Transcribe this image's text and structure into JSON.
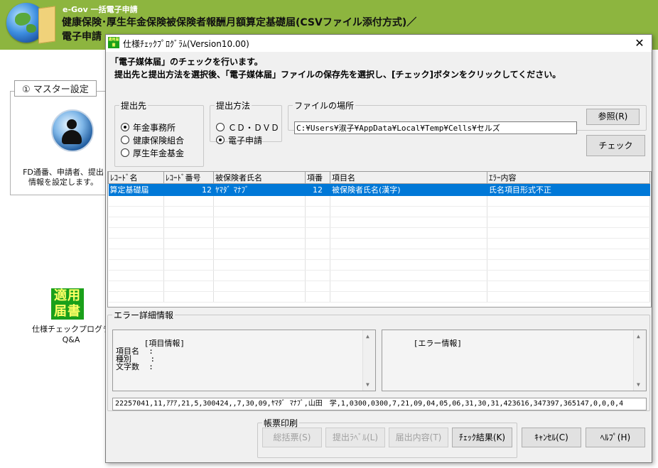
{
  "app": {
    "subtitle": "e-Gov 一括電子申請",
    "title_line1": "健康保険･厚生年金保険被保険者報酬月額算定基礎届(CSVファイル添付方式)／",
    "title_line2": "電子申請",
    "master_tab": "① マスター設定",
    "master_desc": "FD通番、申請者、提出\n情報を設定します。",
    "tekiyo_icon": "適用\n届書",
    "spec_label": "仕様チェックプログラ\nQ&A"
  },
  "dialog": {
    "title": "仕様ﾁｪｯｸﾌﾟﾛｸﾞﾗﾑ(Version10.00)",
    "close": "✕",
    "icon_text": "適用届書",
    "instruction1": "「電子媒体届」のチェックを行います。",
    "instruction2": "提出先と提出方法を選択後、「電子媒体届」ファイルの保存先を選択し、[チェック]ボタンをクリックしてください。",
    "destination": {
      "legend": "提出先",
      "options": [
        "年金事務所",
        "健康保険組合",
        "厚生年金基金"
      ],
      "selected": 0
    },
    "method": {
      "legend": "提出方法",
      "options": [
        "ＣＤ・ＤＶＤ",
        "電子申請"
      ],
      "selected": 1
    },
    "file": {
      "legend": "ファイルの場所",
      "path": "C:¥Users¥淑子¥AppData¥Local¥Temp¥Cells¥セルズ",
      "browse": "参照(R)"
    },
    "check_button": "チェック",
    "grid": {
      "columns": [
        "ﾚｺｰﾄﾞ名",
        "ﾚｺｰﾄﾞ番号",
        "被保険者氏名",
        "項番",
        "項目名",
        "ｴﾗｰ内容"
      ],
      "rows": [
        [
          "算定基礎届",
          "12",
          "ﾔﾏﾀﾞ ﾏﾅﾌﾞ",
          "12",
          "被保険者氏名(漢字)",
          "氏名項目形式不正"
        ]
      ]
    },
    "error_detail": {
      "legend": "エラー詳細情報",
      "item_info": "[項目情報]\n項目名  :\n種別    :\n文字数  :",
      "error_info": "[エラー情報]",
      "data_line": "22257041,11,ｱｱｱ,21,5,300424,,7,30,09,ﾔﾏﾀﾞ ﾏﾅﾌﾞ,山田　学,1,0300,0300,7,21,09,04,05,06,31,30,31,423616,347397,365147,0,0,0,4"
    },
    "print": {
      "legend": "帳票印刷",
      "summary": "総括票(S)",
      "label": "提出ﾗﾍﾞﾙ(L)",
      "content": "届出内容(T)",
      "result": "ﾁｪｯｸ結果(K)"
    },
    "cancel": "ｷｬﾝｾﾙ(C)",
    "help": "ﾍﾙﾌﾟ(H)"
  }
}
